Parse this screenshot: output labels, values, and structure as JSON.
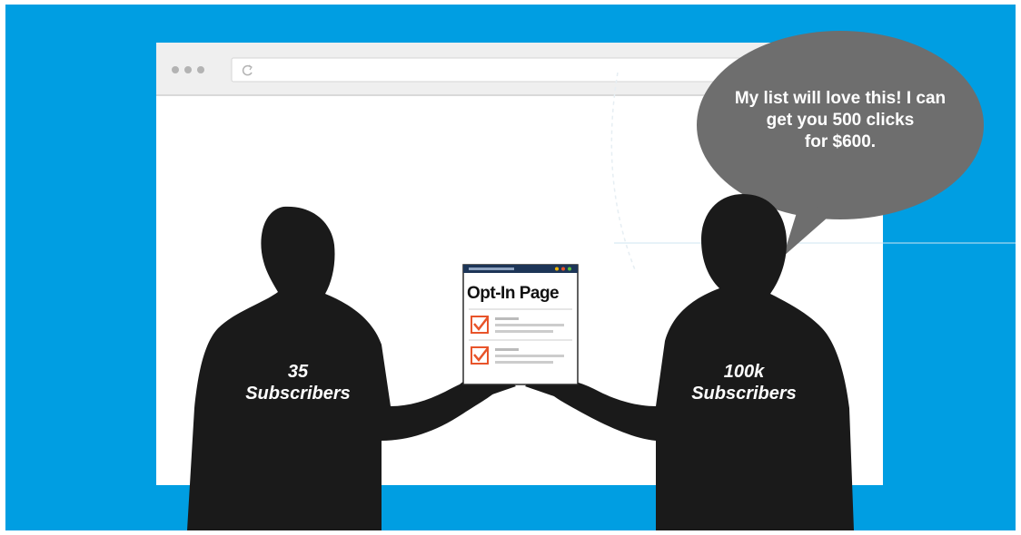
{
  "scene": {
    "background_color": "#009ee2",
    "window_color": "#ffffff",
    "silhouette_color": "#1a1a1a",
    "bubble_color": "#6e6e6e"
  },
  "browser": {
    "address_bar_icon": "refresh-icon",
    "window_controls": [
      "dot",
      "dot",
      "dot"
    ]
  },
  "left_person": {
    "count": "35",
    "label": "Subscribers"
  },
  "right_person": {
    "count": "100k",
    "label": "Subscribers"
  },
  "speech_bubble": {
    "lines": [
      "My list will love this! I can",
      "get you 500 clicks",
      "for $600."
    ]
  },
  "optin_card": {
    "title": "Opt-In Page",
    "accent_color": "#e8542a",
    "header_color": "#1d3557",
    "checkbox_icon": "checkbox-checked-icon"
  }
}
